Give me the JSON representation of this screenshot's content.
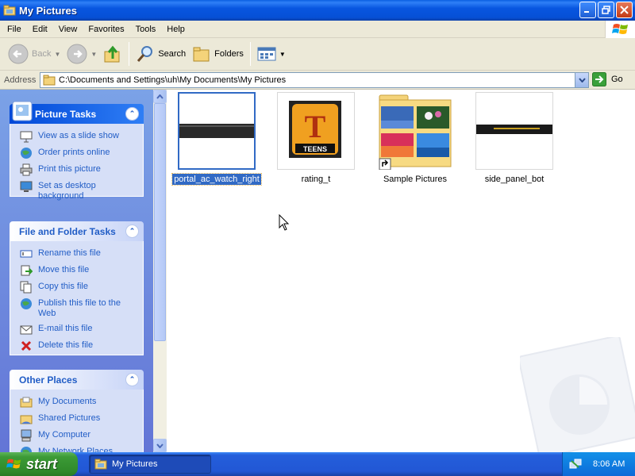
{
  "window": {
    "title": "My Pictures"
  },
  "menu": [
    "File",
    "Edit",
    "View",
    "Favorites",
    "Tools",
    "Help"
  ],
  "toolbar": {
    "back": "Back",
    "search": "Search",
    "folders": "Folders"
  },
  "address": {
    "label": "Address",
    "value": "C:\\Documents and Settings\\uh\\My Documents\\My Pictures",
    "go": "Go"
  },
  "picture_tasks": {
    "title": "Picture Tasks",
    "items": [
      "View as a slide show",
      "Order prints online",
      "Print this picture",
      "Set as desktop background"
    ]
  },
  "file_tasks": {
    "title": "File and Folder Tasks",
    "items": [
      "Rename this file",
      "Move this file",
      "Copy this file",
      "Publish this file to the Web",
      "E-mail this file",
      "Delete this file"
    ]
  },
  "other_places": {
    "title": "Other Places",
    "items": [
      "My Documents",
      "Shared Pictures",
      "My Computer",
      "My Network Places"
    ]
  },
  "files": [
    {
      "name": "portal_ac_watch_right",
      "selected": true
    },
    {
      "name": "rating_t",
      "badge": "TEENS"
    },
    {
      "name": "Sample Pictures"
    },
    {
      "name": "side_panel_bot"
    }
  ],
  "taskbar": {
    "start": "start",
    "window_button": "My Pictures",
    "clock": "8:06 AM"
  },
  "colors": {
    "accent": "#316ac5",
    "title_bar": "#0853d6",
    "task_link": "#215dc6",
    "start_green": "#3c9a36"
  }
}
